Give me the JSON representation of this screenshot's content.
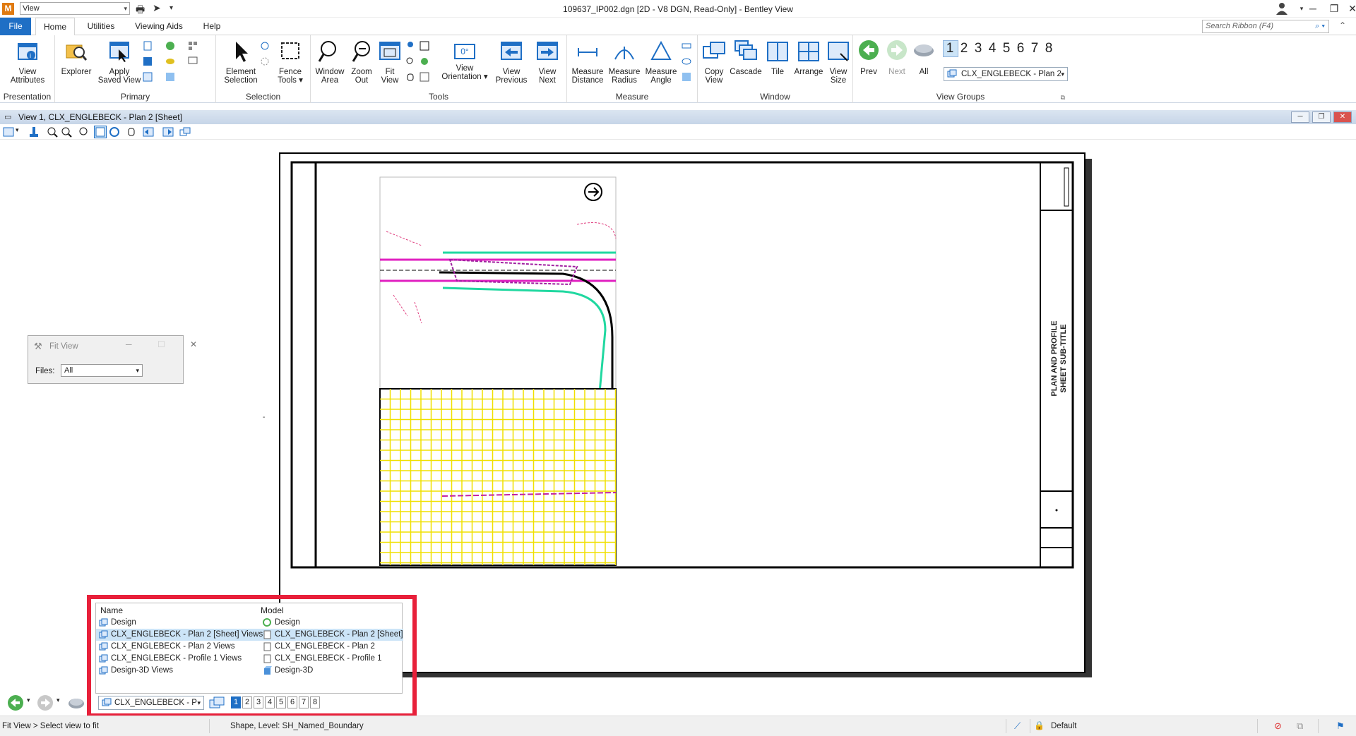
{
  "titlebar": {
    "quick_select": "View",
    "title": "109637_IP002.dgn [2D - V8 DGN, Read-Only] - Bentley View"
  },
  "tabs": {
    "file": "File",
    "home": "Home",
    "utilities": "Utilities",
    "viewing_aids": "Viewing Aids",
    "help": "Help"
  },
  "search": {
    "placeholder": "Search Ribbon (F4)"
  },
  "ribbon": {
    "presentation": {
      "label": "Presentation",
      "view_attributes": "View\nAttributes"
    },
    "primary": {
      "label": "Primary",
      "explorer": "Explorer",
      "apply_saved_view": "Apply\nSaved View"
    },
    "selection": {
      "label": "Selection",
      "element_selection": "Element\nSelection",
      "fence_tools": "Fence\nTools ▾"
    },
    "tools": {
      "label": "Tools",
      "window_area": "Window\nArea",
      "zoom_out": "Zoom\nOut",
      "fit_view": "Fit\nView",
      "view_orientation": "View\nOrientation ▾",
      "orientation_value": "0°",
      "view_previous": "View\nPrevious",
      "view_next": "View\nNext"
    },
    "measure": {
      "label": "Measure",
      "distance": "Measure\nDistance",
      "radius": "Measure\nRadius",
      "angle": "Measure\nAngle"
    },
    "window": {
      "label": "Window",
      "copy_view": "Copy\nView",
      "cascade": "Cascade",
      "tile": "Tile",
      "arrange": "Arrange",
      "view_size": "View\nSize"
    },
    "view_groups": {
      "label": "View Groups",
      "prev": "Prev",
      "next": "Next",
      "all": "All",
      "numbers": [
        "1",
        "2",
        "3",
        "4",
        "5",
        "6",
        "7",
        "8"
      ],
      "selected_group": "CLX_ENGLEBECK - Plan 2"
    }
  },
  "view_window": {
    "title": "View 1, CLX_ENGLEBECK - Plan 2 [Sheet]"
  },
  "fit_view_dialog": {
    "title": "Fit View",
    "files_label": "Files:",
    "files_value": "All"
  },
  "sheet": {
    "title_block_text": "PLAN AND PROFILE\nSHEET SUB-TITLE"
  },
  "popup": {
    "headers": {
      "name": "Name",
      "model": "Model"
    },
    "rows": [
      {
        "name": "Design",
        "model": "Design"
      },
      {
        "name": "CLX_ENGLEBECK - Plan 2 [Sheet] Views",
        "model": "CLX_ENGLEBECK - Plan 2 [Sheet]"
      },
      {
        "name": "CLX_ENGLEBECK - Plan 2 Views",
        "model": "CLX_ENGLEBECK - Plan 2"
      },
      {
        "name": "CLX_ENGLEBECK - Profile 1 Views",
        "model": "CLX_ENGLEBECK - Profile 1"
      },
      {
        "name": "Design-3D Views",
        "model": "Design-3D"
      }
    ],
    "selected_row": 1
  },
  "bottom_nav": {
    "group_select": "CLX_ENGLEBECK - P",
    "numbers": [
      "1",
      "2",
      "3",
      "4",
      "5",
      "6",
      "7",
      "8"
    ]
  },
  "status": {
    "prompt": "Fit View > Select view to fit",
    "element_info": "Shape, Level: SH_Named_Boundary",
    "level": "Default"
  },
  "colors": {
    "accent": "#1f6fc5",
    "highlight": "#e8203a",
    "grid": "#f0e000"
  }
}
